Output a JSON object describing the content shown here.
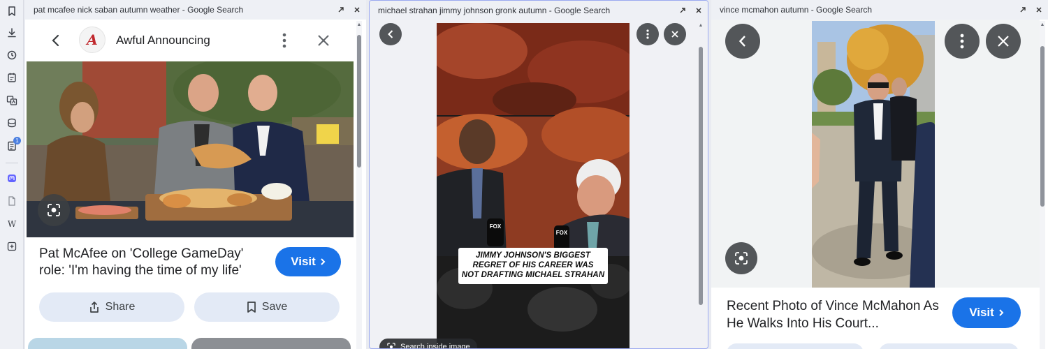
{
  "sidebar": {
    "badge_count": "1",
    "icons": [
      "bookmark-icon",
      "download-icon",
      "history-icon",
      "notes-icon",
      "translate-icon",
      "reading-icon",
      "tasks-icon",
      "mastodon-icon",
      "page-icon",
      "wikipedia-icon",
      "add-panel-icon"
    ]
  },
  "panel1": {
    "window_title": "pat mcafee nick saban autumn weather - Google Search",
    "source_name": "Awful Announcing",
    "article_title": "Pat McAfee on 'College GameDay' role: 'I'm having the time of my life'",
    "visit_label": "Visit",
    "share_label": "Share",
    "save_label": "Save"
  },
  "panel2": {
    "window_title": "michael strahan jimmy johnson gronk autumn - Google Search",
    "caption_line1": "JIMMY JOHNSON'S BIGGEST",
    "caption_line2": "REGRET OF HIS CAREER WAS",
    "caption_line3": "NOT DRAFTING MICHAEL STRAHAN",
    "mic_label": "FOX",
    "search_inside_label": "Search inside image"
  },
  "panel3": {
    "window_title": "vince mcmahon autumn - Google Search",
    "article_title": "Recent Photo of Vince McMahon As He Walks Into His Court...",
    "visit_label": "Visit"
  },
  "colors": {
    "accent_blue": "#1a73e8",
    "pill_bg": "#e3eaf6",
    "sidebar_bg": "#eef0f5",
    "mastodon": "#6364ff",
    "logo_red": "#c0282d"
  }
}
